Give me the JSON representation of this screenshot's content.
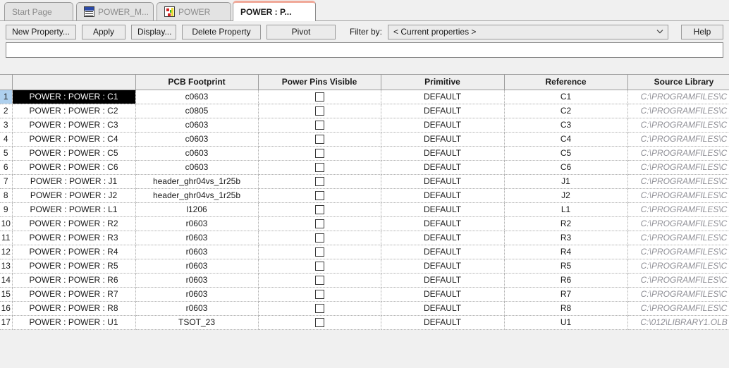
{
  "tabs": [
    {
      "label": "Start Page",
      "icon": null,
      "active": false
    },
    {
      "label": "POWER_M...",
      "icon": "spreadsheet-icon",
      "active": false
    },
    {
      "label": "POWER",
      "icon": "schematic-icon",
      "active": false
    },
    {
      "label": "POWER : P...",
      "icon": null,
      "active": true
    }
  ],
  "toolbar": {
    "new_property": "New Property...",
    "apply": "Apply",
    "display": "Display...",
    "delete_property": "Delete Property",
    "pivot": "Pivot",
    "filter_label": "Filter by:",
    "filter_value": "< Current properties >",
    "help": "Help"
  },
  "edit_field": {
    "value": "",
    "placeholder": ""
  },
  "grid": {
    "columns": [
      {
        "key": "rownum",
        "label": ""
      },
      {
        "key": "name",
        "label": ""
      },
      {
        "key": "footprint",
        "label": "PCB Footprint"
      },
      {
        "key": "pins",
        "label": "Power Pins Visible"
      },
      {
        "key": "primitive",
        "label": "Primitive"
      },
      {
        "key": "reference",
        "label": "Reference"
      },
      {
        "key": "source",
        "label": "Source Library"
      }
    ],
    "selected_row": 1,
    "rows": [
      {
        "n": "1",
        "name": "POWER : POWER : C1",
        "footprint": "c0603",
        "pins": false,
        "primitive": "DEFAULT",
        "reference": "C1",
        "source": "C:\\PROGRAMFILES\\C"
      },
      {
        "n": "2",
        "name": "POWER : POWER : C2",
        "footprint": "c0805",
        "pins": false,
        "primitive": "DEFAULT",
        "reference": "C2",
        "source": "C:\\PROGRAMFILES\\C"
      },
      {
        "n": "3",
        "name": "POWER : POWER : C3",
        "footprint": "c0603",
        "pins": false,
        "primitive": "DEFAULT",
        "reference": "C3",
        "source": "C:\\PROGRAMFILES\\C"
      },
      {
        "n": "4",
        "name": "POWER : POWER : C4",
        "footprint": "c0603",
        "pins": false,
        "primitive": "DEFAULT",
        "reference": "C4",
        "source": "C:\\PROGRAMFILES\\C"
      },
      {
        "n": "5",
        "name": "POWER : POWER : C5",
        "footprint": "c0603",
        "pins": false,
        "primitive": "DEFAULT",
        "reference": "C5",
        "source": "C:\\PROGRAMFILES\\C"
      },
      {
        "n": "6",
        "name": "POWER : POWER : C6",
        "footprint": "c0603",
        "pins": false,
        "primitive": "DEFAULT",
        "reference": "C6",
        "source": "C:\\PROGRAMFILES\\C"
      },
      {
        "n": "7",
        "name": "POWER : POWER : J1",
        "footprint": "header_ghr04vs_1r25b",
        "pins": false,
        "primitive": "DEFAULT",
        "reference": "J1",
        "source": "C:\\PROGRAMFILES\\C"
      },
      {
        "n": "8",
        "name": "POWER : POWER : J2",
        "footprint": "header_ghr04vs_1r25b",
        "pins": false,
        "primitive": "DEFAULT",
        "reference": "J2",
        "source": "C:\\PROGRAMFILES\\C"
      },
      {
        "n": "9",
        "name": "POWER : POWER : L1",
        "footprint": "l1206",
        "pins": false,
        "primitive": "DEFAULT",
        "reference": "L1",
        "source": "C:\\PROGRAMFILES\\C"
      },
      {
        "n": "10",
        "name": "POWER : POWER : R2",
        "footprint": "r0603",
        "pins": false,
        "primitive": "DEFAULT",
        "reference": "R2",
        "source": "C:\\PROGRAMFILES\\C"
      },
      {
        "n": "11",
        "name": "POWER : POWER : R3",
        "footprint": "r0603",
        "pins": false,
        "primitive": "DEFAULT",
        "reference": "R3",
        "source": "C:\\PROGRAMFILES\\C"
      },
      {
        "n": "12",
        "name": "POWER : POWER : R4",
        "footprint": "r0603",
        "pins": false,
        "primitive": "DEFAULT",
        "reference": "R4",
        "source": "C:\\PROGRAMFILES\\C"
      },
      {
        "n": "13",
        "name": "POWER : POWER : R5",
        "footprint": "r0603",
        "pins": false,
        "primitive": "DEFAULT",
        "reference": "R5",
        "source": "C:\\PROGRAMFILES\\C"
      },
      {
        "n": "14",
        "name": "POWER : POWER : R6",
        "footprint": "r0603",
        "pins": false,
        "primitive": "DEFAULT",
        "reference": "R6",
        "source": "C:\\PROGRAMFILES\\C"
      },
      {
        "n": "15",
        "name": "POWER : POWER : R7",
        "footprint": "r0603",
        "pins": false,
        "primitive": "DEFAULT",
        "reference": "R7",
        "source": "C:\\PROGRAMFILES\\C"
      },
      {
        "n": "16",
        "name": "POWER : POWER : R8",
        "footprint": "r0603",
        "pins": false,
        "primitive": "DEFAULT",
        "reference": "R8",
        "source": "C:\\PROGRAMFILES\\C"
      },
      {
        "n": "17",
        "name": "POWER : POWER : U1",
        "footprint": "TSOT_23",
        "pins": false,
        "primitive": "DEFAULT",
        "reference": "U1",
        "source": "C:\\012\\LIBRARY1.OLB"
      }
    ]
  },
  "colors": {
    "selected_column_header": "#aed0ee",
    "selected_row_cell": "#000000",
    "active_tab_accent": "#f0a898",
    "source_text": "#8f8f96",
    "window_bg": "#f0f0f0"
  }
}
